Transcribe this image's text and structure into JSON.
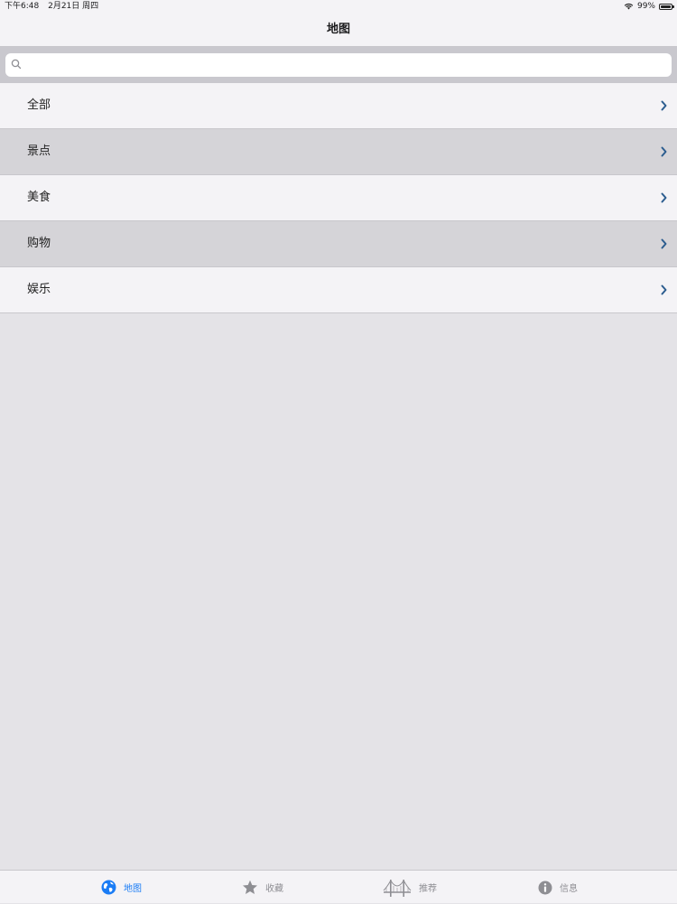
{
  "status_bar": {
    "time": "下午6:48",
    "date": "2月21日 周四",
    "battery": "99%"
  },
  "nav": {
    "title": "地图"
  },
  "search": {
    "placeholder": ""
  },
  "list": {
    "items": [
      {
        "label": "全部"
      },
      {
        "label": "景点"
      },
      {
        "label": "美食"
      },
      {
        "label": "购物"
      },
      {
        "label": "娱乐"
      }
    ]
  },
  "tab_bar": {
    "tabs": [
      {
        "label": "地图",
        "icon": "globe-icon",
        "active": true
      },
      {
        "label": "收藏",
        "icon": "star-icon"
      },
      {
        "label": "推荐",
        "icon": "bridge-icon"
      },
      {
        "label": "信息",
        "icon": "info-icon"
      }
    ]
  },
  "colors": {
    "accent": "#1a7cf5",
    "chevron": "#2c5d8f",
    "inactive": "#8e8e93"
  }
}
